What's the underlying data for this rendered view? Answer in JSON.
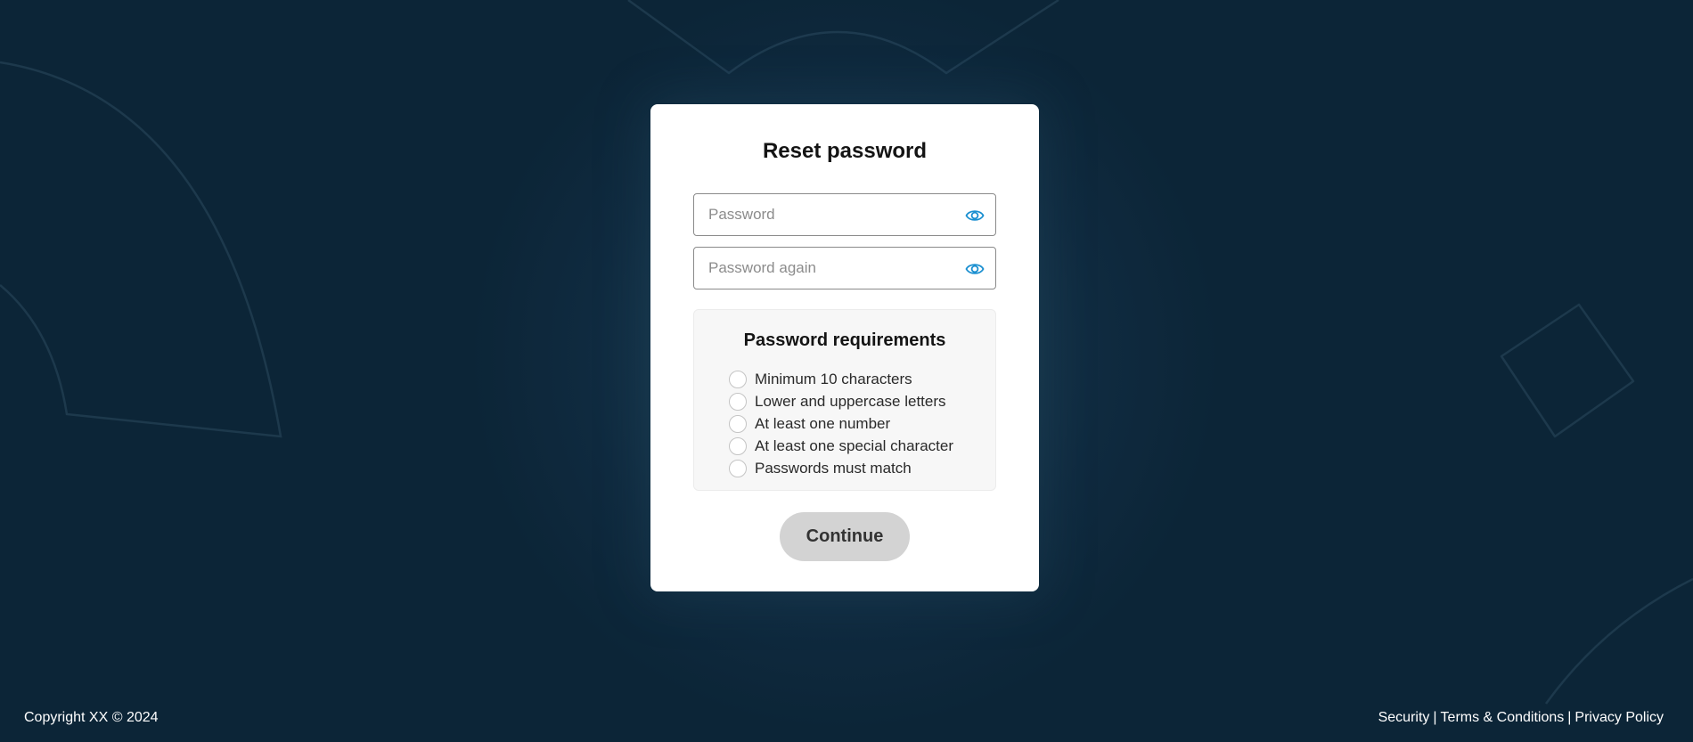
{
  "card": {
    "title": "Reset password"
  },
  "fields": {
    "password": {
      "value": "",
      "placeholder": "Password",
      "toggle_icon": "eye-icon"
    },
    "password_again": {
      "value": "",
      "placeholder": "Password again",
      "toggle_icon": "eye-icon"
    }
  },
  "requirements": {
    "title": "Password requirements",
    "items": [
      {
        "label": "Minimum 10 characters",
        "met": false
      },
      {
        "label": "Lower and uppercase letters",
        "met": false
      },
      {
        "label": "At least one number",
        "met": false
      },
      {
        "label": "At least one special character",
        "met": false
      },
      {
        "label": "Passwords must match",
        "met": false
      }
    ]
  },
  "actions": {
    "continue_label": "Continue",
    "continue_disabled": true
  },
  "footer": {
    "copyright": "Copyright XX © 2024",
    "links": [
      "Security",
      "Terms & Conditions",
      "Privacy Policy"
    ],
    "separator": "|"
  },
  "colors": {
    "background": "#0f2a3f",
    "card": "#ffffff",
    "accent_icon": "#1a8fd0",
    "button_disabled": "#d3d3d3"
  }
}
